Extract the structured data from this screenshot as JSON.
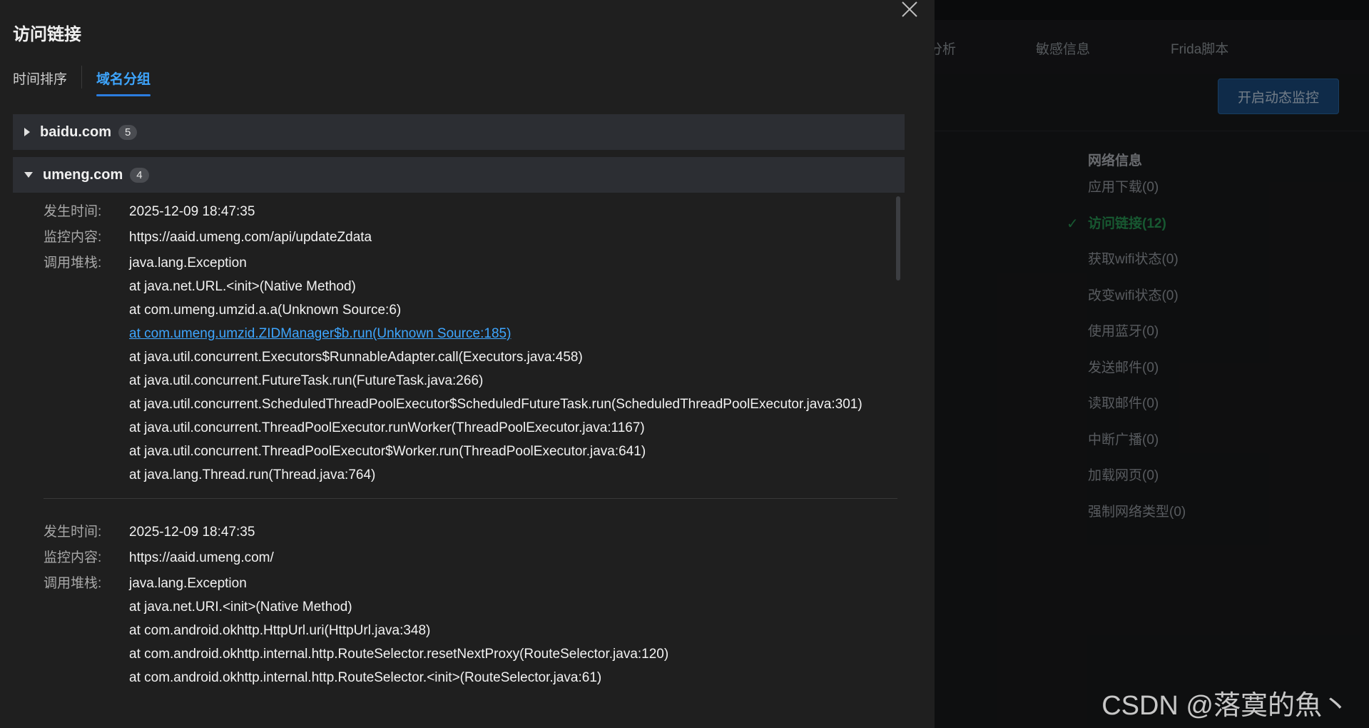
{
  "background": {
    "tabs": [
      "分析",
      "敏感信息",
      "Frida脚本"
    ],
    "monitor_button": "开启动态监控",
    "menu": {
      "title": "网络信息",
      "items": [
        {
          "label": "应用下载(0)",
          "active": false
        },
        {
          "label": "访问链接(12)",
          "active": true
        },
        {
          "label": "获取wifi状态(0)",
          "active": false
        },
        {
          "label": "改变wifi状态(0)",
          "active": false
        },
        {
          "label": "使用蓝牙(0)",
          "active": false
        },
        {
          "label": "发送邮件(0)",
          "active": false
        },
        {
          "label": "读取邮件(0)",
          "active": false
        },
        {
          "label": "中断广播(0)",
          "active": false
        },
        {
          "label": "加载网页(0)",
          "active": false
        },
        {
          "label": "强制网络类型(0)",
          "active": false
        }
      ]
    },
    "watermark": "CSDN @落寞的魚丶"
  },
  "drawer": {
    "title": "访问链接",
    "tabs": [
      {
        "label": "时间排序",
        "active": false
      },
      {
        "label": "域名分组",
        "active": true
      }
    ],
    "labels": {
      "time": "发生时间:",
      "content": "监控内容:",
      "stack": "调用堆栈:"
    },
    "groups": [
      {
        "domain": "baidu.com",
        "count": "5",
        "expanded": false
      },
      {
        "domain": "umeng.com",
        "count": "4",
        "expanded": true
      }
    ],
    "records": [
      {
        "time": "2025-12-09 18:47:35",
        "content": "https://aaid.umeng.com/api/updateZdata",
        "stack": [
          "java.lang.Exception",
          "at java.net.URL.<init>(Native Method)",
          "at com.umeng.umzid.a.a(Unknown Source:6)",
          "at com.umeng.umzid.ZIDManager$b.run(Unknown Source:185)",
          "at java.util.concurrent.Executors$RunnableAdapter.call(Executors.java:458)",
          "at java.util.concurrent.FutureTask.run(FutureTask.java:266)",
          "at java.util.concurrent.ScheduledThreadPoolExecutor$ScheduledFutureTask.run(ScheduledThreadPoolExecutor.java:301)",
          "at java.util.concurrent.ThreadPoolExecutor.runWorker(ThreadPoolExecutor.java:1167)",
          "at java.util.concurrent.ThreadPoolExecutor$Worker.run(ThreadPoolExecutor.java:641)",
          "at java.lang.Thread.run(Thread.java:764)"
        ],
        "link_line": 3
      },
      {
        "time": "2025-12-09 18:47:35",
        "content": "https://aaid.umeng.com/",
        "stack": [
          "java.lang.Exception",
          "at java.net.URI.<init>(Native Method)",
          "at com.android.okhttp.HttpUrl.uri(HttpUrl.java:348)",
          "at com.android.okhttp.internal.http.RouteSelector.resetNextProxy(RouteSelector.java:120)",
          "at com.android.okhttp.internal.http.RouteSelector.<init>(RouteSelector.java:61)"
        ],
        "link_line": -1
      }
    ]
  }
}
